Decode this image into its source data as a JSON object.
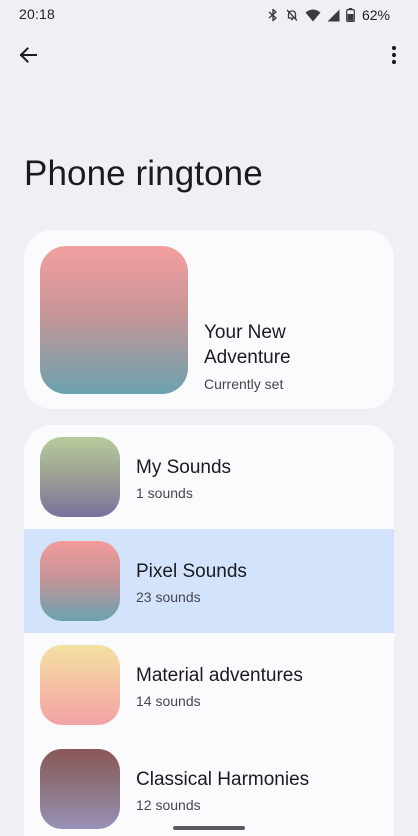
{
  "status_bar": {
    "time": "20:18",
    "battery_percent": "62%",
    "icons": [
      "bluetooth-icon",
      "notifications-off-icon",
      "wifi-icon",
      "signal-icon",
      "battery-icon"
    ]
  },
  "app_bar": {
    "back_icon": "arrow-back-icon",
    "more_icon": "more-vert-icon"
  },
  "page": {
    "title": "Phone ringtone"
  },
  "current": {
    "name": "Your New Adventure",
    "status": "Currently set"
  },
  "categories": [
    {
      "title": "My Sounds",
      "subtitle": "1 sounds",
      "selected": false
    },
    {
      "title": "Pixel Sounds",
      "subtitle": "23 sounds",
      "selected": true
    },
    {
      "title": "Material adventures",
      "subtitle": "14 sounds",
      "selected": false
    },
    {
      "title": "Classical Harmonies",
      "subtitle": "12 sounds",
      "selected": false
    }
  ],
  "colors": {
    "background": "#f0eff5",
    "card": "#fbfafd",
    "selected_row": "#d3e3fc",
    "text_primary": "#1b1b1f",
    "text_secondary": "#46464f"
  }
}
